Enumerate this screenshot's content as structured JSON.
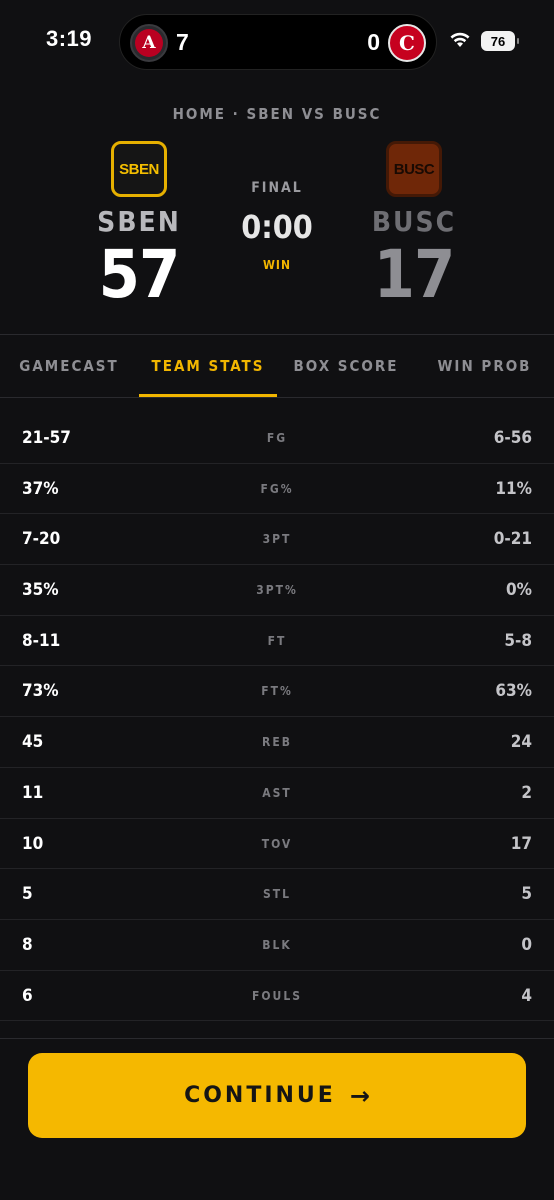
{
  "status_bar": {
    "time": "3:19",
    "live_activity": {
      "left_team_icon": "angels-logo-icon",
      "left_score": "7",
      "right_team_icon": "reds-logo-icon",
      "right_score": "0"
    },
    "wifi_icon": "wifi-icon",
    "battery_level": "76"
  },
  "header": {
    "breadcrumb": "HOME · SBEN VS BUSC",
    "home": {
      "badge": "SBEN",
      "abbr": "SBEN",
      "score": "57"
    },
    "away": {
      "badge": "BUSC",
      "abbr": "BUSC",
      "score": "17"
    },
    "status": "FINAL",
    "clock": "0:00",
    "result": "WIN"
  },
  "tabs": [
    {
      "label": "GAMECAST",
      "active": false
    },
    {
      "label": "TEAM STATS",
      "active": true
    },
    {
      "label": "BOX SCORE",
      "active": false
    },
    {
      "label": "WIN PROB",
      "active": false
    }
  ],
  "stats": [
    {
      "home": "21-57",
      "label": "FG",
      "away": "6-56"
    },
    {
      "home": "37%",
      "label": "FG%",
      "away": "11%"
    },
    {
      "home": "7-20",
      "label": "3PT",
      "away": "0-21"
    },
    {
      "home": "35%",
      "label": "3PT%",
      "away": "0%"
    },
    {
      "home": "8-11",
      "label": "FT",
      "away": "5-8"
    },
    {
      "home": "73%",
      "label": "FT%",
      "away": "63%"
    },
    {
      "home": "45",
      "label": "REB",
      "away": "24"
    },
    {
      "home": "11",
      "label": "AST",
      "away": "2"
    },
    {
      "home": "10",
      "label": "TOV",
      "away": "17"
    },
    {
      "home": "5",
      "label": "STL",
      "away": "5"
    },
    {
      "home": "8",
      "label": "BLK",
      "away": "0"
    },
    {
      "home": "6",
      "label": "FOULS",
      "away": "4"
    }
  ],
  "continue": {
    "label": "CONTINUE",
    "arrow": "→"
  },
  "colors": {
    "accent": "#f5b800",
    "background": "#101012"
  }
}
